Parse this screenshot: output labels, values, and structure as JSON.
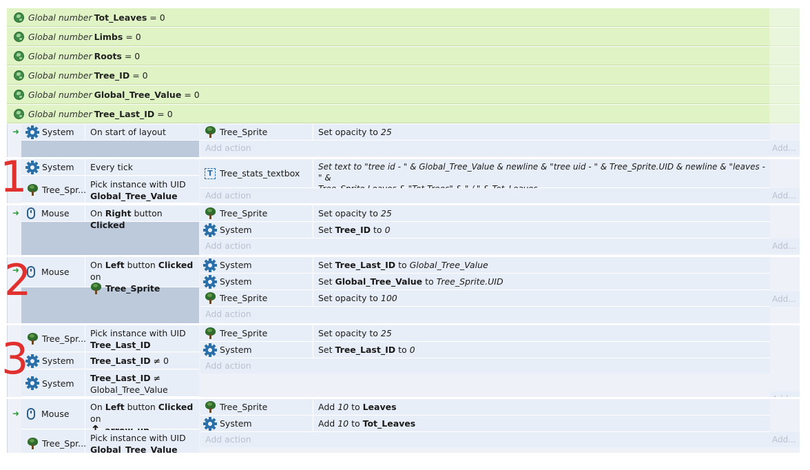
{
  "globals": [
    {
      "prefix": "Global number",
      "name": "Tot_Leaves",
      "value": "= 0"
    },
    {
      "prefix": "Global number",
      "name": "Limbs",
      "value": "= 0"
    },
    {
      "prefix": "Global number",
      "name": "Roots",
      "value": "= 0"
    },
    {
      "prefix": "Global number",
      "name": "Tree_ID",
      "value": "= 0"
    },
    {
      "prefix": "Global number",
      "name": "Global_Tree_Value",
      "value": "= 0"
    },
    {
      "prefix": "Global number",
      "name": "Tree_Last_ID",
      "value": "= 0"
    }
  ],
  "labels": {
    "add_action": "Add action",
    "add_right": "Add...",
    "add_right_cut": "Add..."
  },
  "annotations": [
    "1",
    "2",
    "3"
  ],
  "events": {
    "e1": {
      "cond_obj": "System",
      "cond_text": "On start of layout",
      "actions": [
        {
          "obj": "Tree_Sprite",
          "pre": "Set opacity to ",
          "val": "25"
        }
      ]
    },
    "e2": {
      "c1_obj": "System",
      "c1_text": "Every tick",
      "c2_obj": "Tree_Spr...",
      "c2_line1": "Pick instance with UID",
      "c2_line2": "Global_Tree_Value",
      "a1_obj": "Tree_stats_textbox",
      "a1_text_1": "Set text to \"tree id - \" & Global_Tree_Value & newline & \"tree uid - \" & Tree_Sprite.UID & newline & \"leaves - \" &",
      "a1_text_2": "Tree_Sprite.Leaves & \"Tot Trees\" & \" / \" & Tot_Leaves"
    },
    "e3": {
      "cond_obj": "Mouse",
      "cond_on": "On ",
      "cond_btn": "Right",
      "cond_mid": " button ",
      "cond_clicked": "Clicked",
      "a1_obj": "Tree_Sprite",
      "a1_pre": "Set opacity to ",
      "a1_val": "25",
      "a2_obj": "System",
      "a2_pre": "Set ",
      "a2_var": "Tree_ID",
      "a2_mid": " to ",
      "a2_val": "0"
    },
    "e4": {
      "cond_obj": "Mouse",
      "cond_on": "On ",
      "cond_btn": "Left",
      "cond_mid": " button ",
      "cond_clicked": "Clicked",
      "cond_tail": " on",
      "cond_target": "Tree_Sprite",
      "a1_obj": "System",
      "a1_pre": "Set ",
      "a1_var": "Tree_Last_ID",
      "a1_mid": " to ",
      "a1_val": "Global_Tree_Value",
      "a2_obj": "System",
      "a2_pre": "Set ",
      "a2_var": "Global_Tree_Value",
      "a2_mid": " to ",
      "a2_val": "Tree_Sprite.UID",
      "a3_obj": "Tree_Sprite",
      "a3_pre": "Set opacity to ",
      "a3_val": "100"
    },
    "e5": {
      "c1_obj": "Tree_Spr...",
      "c1_line1": "Pick instance with UID",
      "c1_line2": "Tree_Last_ID",
      "c2_obj": "System",
      "c2_var": "Tree_Last_ID",
      "c2_rest": " ≠ 0",
      "c3_obj": "System",
      "c3_var": "Tree_Last_ID",
      "c3_rest": " ≠",
      "c3_line2": "Global_Tree_Value",
      "a1_obj": "Tree_Sprite",
      "a1_pre": "Set opacity to ",
      "a1_val": "25",
      "a2_obj": "System",
      "a2_pre": "Set ",
      "a2_var": "Tree_Last_ID",
      "a2_mid": " to ",
      "a2_val": "0"
    },
    "e6": {
      "c1_obj": "Mouse",
      "c1_on": "On ",
      "c1_btn": "Left",
      "c1_mid": " button ",
      "c1_clicked": "Clicked",
      "c1_tail": " on",
      "c1_target": "arrow_up",
      "c2_obj": "Tree_Spr...",
      "c2_line1": "Pick instance with UID",
      "c2_line2": "Global_Tree_Value",
      "a1_obj": "Tree_Sprite",
      "a1_pre": "Add ",
      "a1_val": "10",
      "a1_mid": " to ",
      "a1_var": "Leaves",
      "a2_obj": "System",
      "a2_pre": "Add ",
      "a2_val": "10",
      "a2_mid": " to ",
      "a2_var": "Tot_Leaves"
    }
  }
}
